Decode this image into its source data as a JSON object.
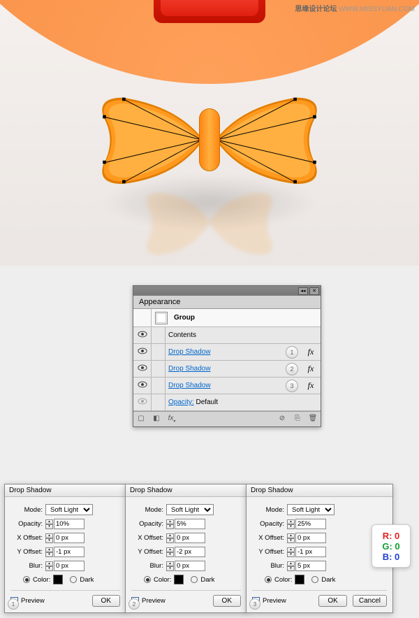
{
  "watermark": {
    "cn": "思缘设计论坛",
    "url": "WWW.MISSYUAN.COM"
  },
  "appearance": {
    "title": "Appearance",
    "group_label": "Group",
    "contents_label": "Contents",
    "rows": [
      {
        "label": "Drop Shadow",
        "badge": "1"
      },
      {
        "label": "Drop Shadow",
        "badge": "2"
      },
      {
        "label": "Drop Shadow",
        "badge": "3"
      }
    ],
    "opacity_label": "Opacity:",
    "opacity_value": "Default",
    "fx_label": "fx"
  },
  "dialogs": [
    {
      "title": "Drop Shadow",
      "badge": "1",
      "mode_label": "Mode:",
      "mode_value": "Soft Light",
      "opacity_label": "Opacity:",
      "opacity_value": "10%",
      "xoffset_label": "X Offset:",
      "xoffset_value": "0 px",
      "yoffset_label": "Y Offset:",
      "yoffset_value": "-1 px",
      "blur_label": "Blur:",
      "blur_value": "0 px",
      "color_label": "Color:",
      "dark_label": "Dark",
      "preview_label": "Preview",
      "ok_label": "OK"
    },
    {
      "title": "Drop Shadow",
      "badge": "2",
      "mode_label": "Mode:",
      "mode_value": "Soft Light",
      "opacity_label": "Opacity:",
      "opacity_value": "5%",
      "xoffset_label": "X Offset:",
      "xoffset_value": "0 px",
      "yoffset_label": "Y Offset:",
      "yoffset_value": "-2 px",
      "blur_label": "Blur:",
      "blur_value": "0 px",
      "color_label": "Color:",
      "dark_label": "Dark",
      "preview_label": "Preview",
      "ok_label": "OK"
    },
    {
      "title": "Drop Shadow",
      "badge": "3",
      "mode_label": "Mode:",
      "mode_value": "Soft Light",
      "opacity_label": "Opacity:",
      "opacity_value": "25%",
      "xoffset_label": "X Offset:",
      "xoffset_value": "0 px",
      "yoffset_label": "Y Offset:",
      "yoffset_value": "-1 px",
      "blur_label": "Blur:",
      "blur_value": "5 px",
      "color_label": "Color:",
      "dark_label": "Dark",
      "preview_label": "Preview",
      "ok_label": "OK",
      "cancel_label": "Cancel"
    }
  ],
  "rgb": {
    "r": "R: 0",
    "g": "G: 0",
    "b": "B: 0"
  }
}
